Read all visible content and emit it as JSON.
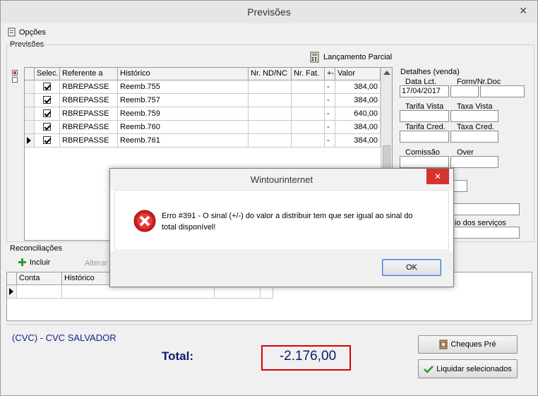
{
  "window": {
    "title": "Previsões",
    "close_glyph": "✕"
  },
  "menu": {
    "options_label": "Opções"
  },
  "previsoes": {
    "group_label": "Previsões",
    "partial_button": "Lançamento Parcial",
    "columns": [
      "Selec.",
      "Referente a",
      "Histórico",
      "Nr. ND/NC",
      "Nr. Fat.",
      "+-",
      "Valor"
    ],
    "rows": [
      {
        "ref": "RBREPASSE",
        "hist": "Reemb.755",
        "sign": "-",
        "valor": "384,00"
      },
      {
        "ref": "RBREPASSE",
        "hist": "Reemb.757",
        "sign": "-",
        "valor": "384,00"
      },
      {
        "ref": "RBREPASSE",
        "hist": "Reemb.759",
        "sign": "-",
        "valor": "640,00"
      },
      {
        "ref": "RBREPASSE",
        "hist": "Reemb.760",
        "sign": "-",
        "valor": "384,00"
      },
      {
        "ref": "RBREPASSE",
        "hist": "Reemb.761",
        "sign": "-",
        "valor": "384,00"
      }
    ]
  },
  "detalhes": {
    "group_label": "Detalhes (venda)",
    "data_lct_label": "Data Lct.",
    "data_lct_value": "17/04/2017",
    "form_nr_label": "Form/Nr.Doc",
    "tarifa_vista_label": "Tarifa Vista",
    "taxa_vista_label": "Taxa Vista",
    "tarifa_cred_label": "Tarifa Cred.",
    "taxa_cred_label": "Taxa Cred.",
    "comissao_label": "Comissão",
    "over_label": "Over",
    "servicos_partial_label": "io dos serviços"
  },
  "reconciliacoes": {
    "group_label": "Reconciliações",
    "add_label": "Incluir",
    "edit_label": "Alterar",
    "columns": [
      "Conta",
      "Histórico"
    ]
  },
  "footer": {
    "client": "(CVC) - CVC SALVADOR",
    "total_label": "Total:",
    "total_value": "-2.176,00",
    "cheques_button": "Cheques Pré",
    "liquidar_button": "Liquidar selecionados"
  },
  "dialog": {
    "title": "Wintourinternet",
    "message": "Erro #391 - O sinal (+/-) do valor a distribuir tem que ser igual ao sinal do total disponível!",
    "ok_label": "OK",
    "close_glyph": "✕"
  },
  "colors": {
    "error_red": "#d21a1a",
    "total_border": "#e00000",
    "total_blue": "#0a1a6e",
    "client_blue": "#13208a"
  }
}
